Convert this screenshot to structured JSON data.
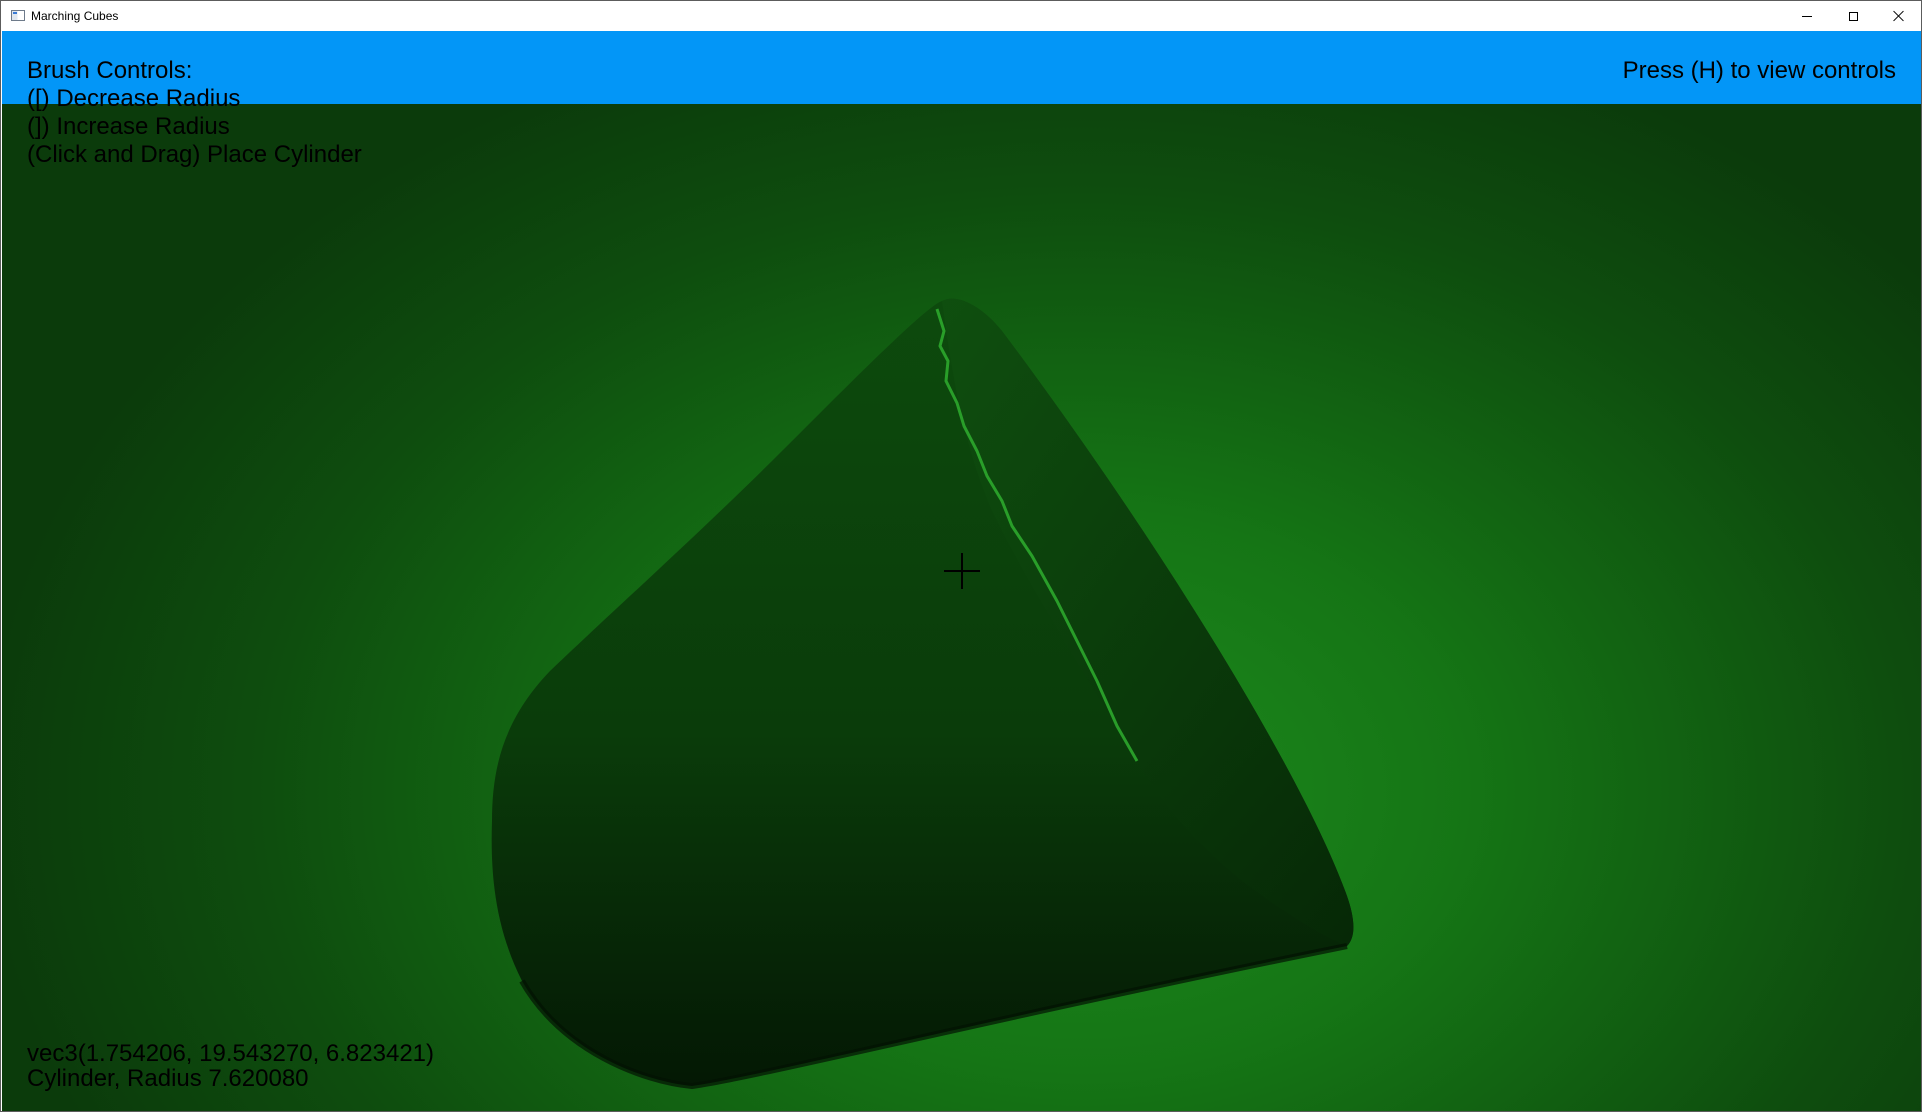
{
  "window": {
    "title": "Marching Cubes"
  },
  "hud": {
    "brush_controls": [
      "Brush Controls:",
      "([) Decrease Radius",
      "(]) Increase Radius",
      "(Click and Drag) Place Cylinder"
    ],
    "help_hint": "Press (H) to view controls",
    "position_readout": "vec3(1.754206, 19.543270, 6.823421)",
    "brush_readout": "Cylinder, Radius 7.620080"
  },
  "colors": {
    "top_strip": "#0396f7",
    "background_green": "#157515",
    "mesh_dark_green": "#0b3f0b",
    "text": "#000000"
  },
  "icons": {
    "app_icon": "app-window-icon",
    "minimize": "minimize-icon",
    "maximize": "maximize-icon",
    "close": "close-icon",
    "cursor": "crosshair-icon"
  }
}
